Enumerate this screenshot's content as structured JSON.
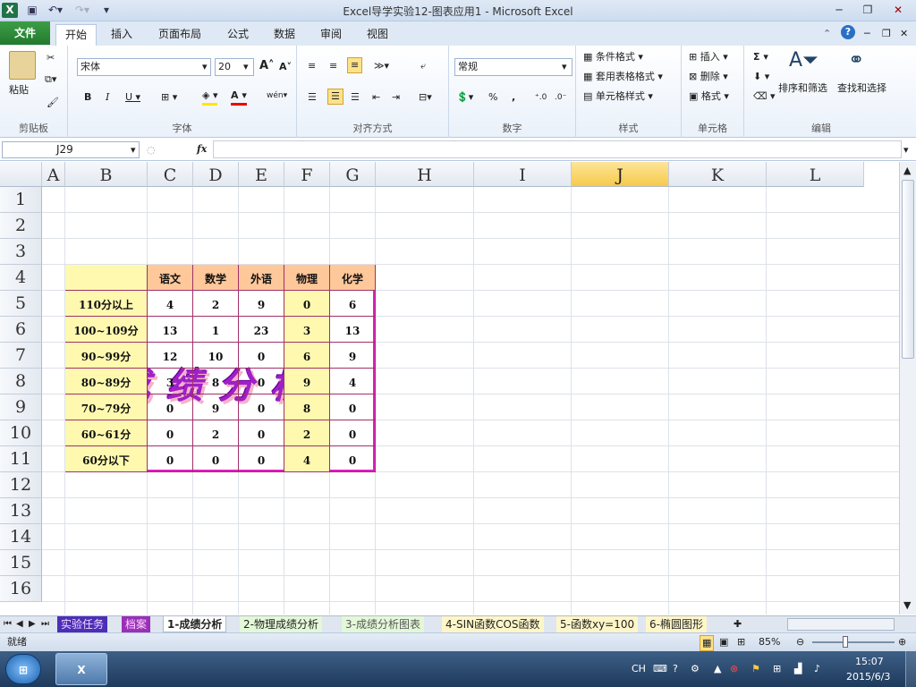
{
  "window": {
    "title": "Excel导学实验12-图表应用1 - Microsoft Excel"
  },
  "tabs": [
    "文件",
    "开始",
    "插入",
    "页面布局",
    "公式",
    "数据",
    "审阅",
    "视图"
  ],
  "ribbon": {
    "clipboard": {
      "paste": "粘贴",
      "label": "剪贴板"
    },
    "font": {
      "name": "宋体",
      "size": "20",
      "label": "字体"
    },
    "alignment": {
      "label": "对齐方式"
    },
    "number": {
      "format": "常规",
      "label": "数字",
      "percent": "%",
      "comma": ","
    },
    "styles": {
      "conditional": "条件格式",
      "table": "套用表格格式",
      "cell": "单元格样式",
      "label": "样式"
    },
    "cells": {
      "insert": "插入",
      "delete": "删除",
      "format": "格式",
      "label": "单元格"
    },
    "editing": {
      "sort": "排序和筛选",
      "find": "查找和选择",
      "label": "编辑"
    }
  },
  "formula_bar": {
    "name_box": "J29",
    "fx": "fx",
    "value": ""
  },
  "columns": [
    "A",
    "B",
    "C",
    "D",
    "E",
    "F",
    "G",
    "H",
    "I",
    "J",
    "K",
    "L"
  ],
  "rows": [
    "1",
    "2",
    "3",
    "4",
    "5",
    "6",
    "7",
    "8",
    "9",
    "10",
    "11",
    "12",
    "13",
    "14",
    "15",
    "16"
  ],
  "selected_column": "J",
  "wordart": "成绩分析",
  "table": {
    "headers": [
      "",
      "语文",
      "数学",
      "外语",
      "物理",
      "化学"
    ],
    "rows": [
      {
        "label": "110分以上",
        "values": [
          "4",
          "2",
          "9",
          "0",
          "6"
        ]
      },
      {
        "label": "100~109分",
        "values": [
          "13",
          "1",
          "23",
          "3",
          "13"
        ]
      },
      {
        "label": "90~99分",
        "values": [
          "12",
          "10",
          "0",
          "6",
          "9"
        ]
      },
      {
        "label": "80~89分",
        "values": [
          "3",
          "8",
          "0",
          "9",
          "4"
        ]
      },
      {
        "label": "70~79分",
        "values": [
          "0",
          "9",
          "0",
          "8",
          "0"
        ]
      },
      {
        "label": "60~61分",
        "values": [
          "0",
          "2",
          "0",
          "2",
          "0"
        ]
      },
      {
        "label": "60分以下",
        "values": [
          "0",
          "0",
          "0",
          "4",
          "0"
        ]
      }
    ]
  },
  "sheets": [
    "实验任务",
    "档案",
    "1-成绩分析",
    "2-物理成绩分析",
    "3-成绩分析图表",
    "4-SIN函数COS函数",
    "5-函数xy=100",
    "6-椭圆图形"
  ],
  "active_sheet": "1-成绩分析",
  "status": {
    "mode": "就绪",
    "zoom": "85%"
  },
  "taskbar": {
    "lang": "CH",
    "time": "15:07",
    "date": "2015/6/3"
  },
  "colors": {
    "accent": "#217346",
    "border": "#e020c0",
    "header": "#ffc89a",
    "highlight": "#fff9b0"
  }
}
